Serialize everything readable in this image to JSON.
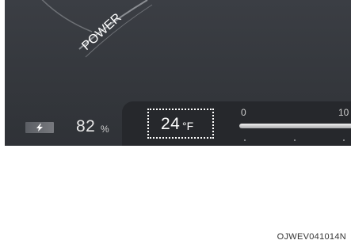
{
  "gauge": {
    "label": "POWER"
  },
  "battery": {
    "icon": "battery-charge-icon",
    "value": "82",
    "unit": "%"
  },
  "temperature": {
    "value": "24",
    "unit": "°F"
  },
  "scale": {
    "min_label": "0",
    "max_label": "10"
  },
  "caption": {
    "code": "OJWEV041014N"
  },
  "colors": {
    "cluster_bg": "#3b3e44",
    "panel_bg": "#26282c",
    "text": "#e8e8e8",
    "gauge_stroke": "#8b8e93"
  }
}
